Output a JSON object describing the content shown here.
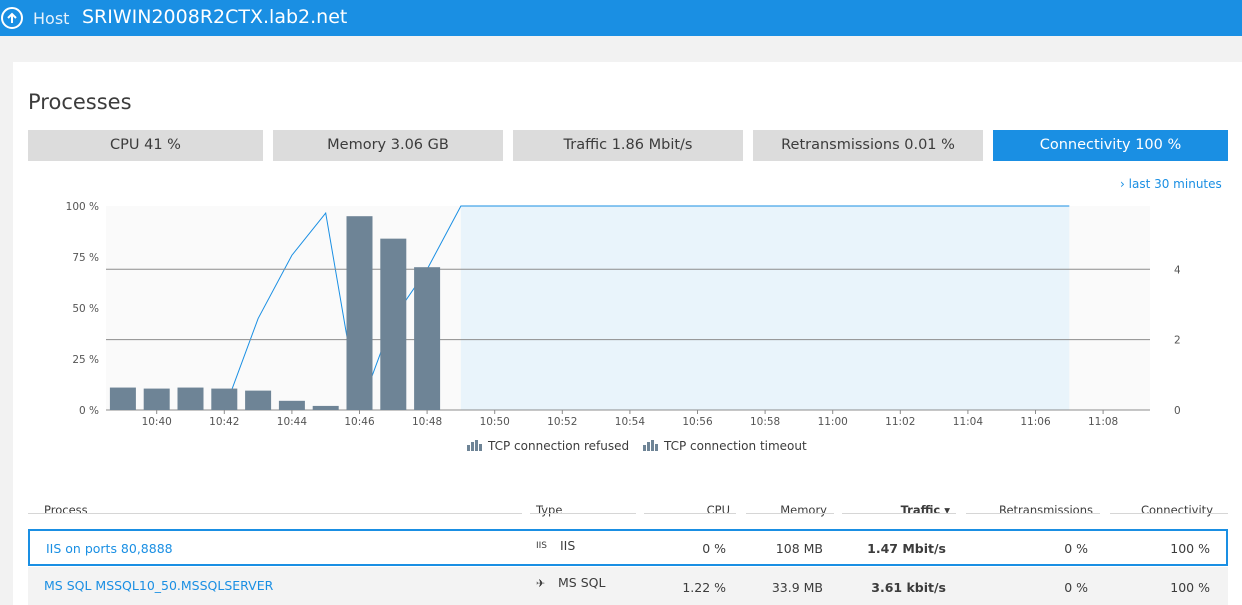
{
  "header": {
    "breadcrumb": "Host",
    "host_name": "SRIWIN2008R2CTX.lab2.net"
  },
  "page": {
    "title": "Processes",
    "timeframe": "last 30 minutes"
  },
  "tiles": [
    {
      "label": "CPU 41 %",
      "active": false
    },
    {
      "label": "Memory 3.06 GB",
      "active": false
    },
    {
      "label": "Traffic 1.86 Mbit/s",
      "active": false
    },
    {
      "label": "Retransmissions 0.01 %",
      "active": false
    },
    {
      "label": "Connectivity 100 %",
      "active": true
    }
  ],
  "chart_data": {
    "type": "bar",
    "x_ticks": [
      "10:40",
      "10:42",
      "10:44",
      "10:46",
      "10:48",
      "10:50",
      "10:52",
      "10:54",
      "10:56",
      "10:58",
      "11:00",
      "11:02",
      "11:04",
      "11:06",
      "11:08"
    ],
    "y_left_ticks": [
      "100 %",
      "75 %",
      "50 %",
      "25 %",
      "0 %"
    ],
    "y_left_range": [
      0,
      100
    ],
    "y_right_ticks": [
      "4 /s",
      "2 /s",
      "0 /s"
    ],
    "y_right_range": [
      0,
      5.8
    ],
    "bars": {
      "times": [
        "10:39",
        "10:40",
        "10:41",
        "10:42",
        "10:43",
        "10:44",
        "10:45",
        "10:46",
        "10:47",
        "10:48"
      ],
      "values": [
        11,
        10.5,
        11,
        10.5,
        9.5,
        4.5,
        2,
        95,
        84,
        70
      ]
    },
    "connectivity_line": {
      "points": [
        [
          "10:42",
          0
        ],
        [
          "10:43",
          2.6
        ],
        [
          "10:44",
          4.4
        ],
        [
          "10:45",
          5.6
        ],
        [
          "10:46",
          0
        ],
        [
          "10:47",
          2.6
        ],
        [
          "10:48",
          4
        ],
        [
          "10:49",
          5.8
        ],
        [
          "11:07",
          5.8
        ]
      ]
    },
    "legend": [
      {
        "label": "TCP connection refused"
      },
      {
        "label": "TCP connection timeout"
      }
    ],
    "colors": {
      "bar": "#6e8496",
      "line": "#1a8fe3",
      "area": "#e9f4fb"
    }
  },
  "table": {
    "headers": {
      "process": "Process",
      "type": "Type",
      "cpu": "CPU",
      "memory": "Memory",
      "traffic": "Traffic ▾",
      "retransmissions": "Retransmissions",
      "connectivity": "Connectivity"
    },
    "rows": [
      {
        "process": "IIS on ports 80,8888",
        "type_icon": "iis-icon",
        "type_glyph": "IIS",
        "type": "IIS",
        "cpu": "0 %",
        "memory": "108 MB",
        "traffic": "1.47 Mbit/s",
        "retransmissions": "0 %",
        "connectivity": "100 %"
      },
      {
        "process": "MS SQL MSSQL10_50.MSSQLSERVER",
        "type_icon": "mssql-icon",
        "type_glyph": "✈",
        "type": "MS SQL",
        "cpu": "1.22 %",
        "memory": "33.9 MB",
        "traffic": "3.61 kbit/s",
        "retransmissions": "0 %",
        "connectivity": "100 %"
      }
    ]
  },
  "colors": {
    "accent": "#1a8fe3",
    "tile_bg": "#dcdcdc"
  }
}
